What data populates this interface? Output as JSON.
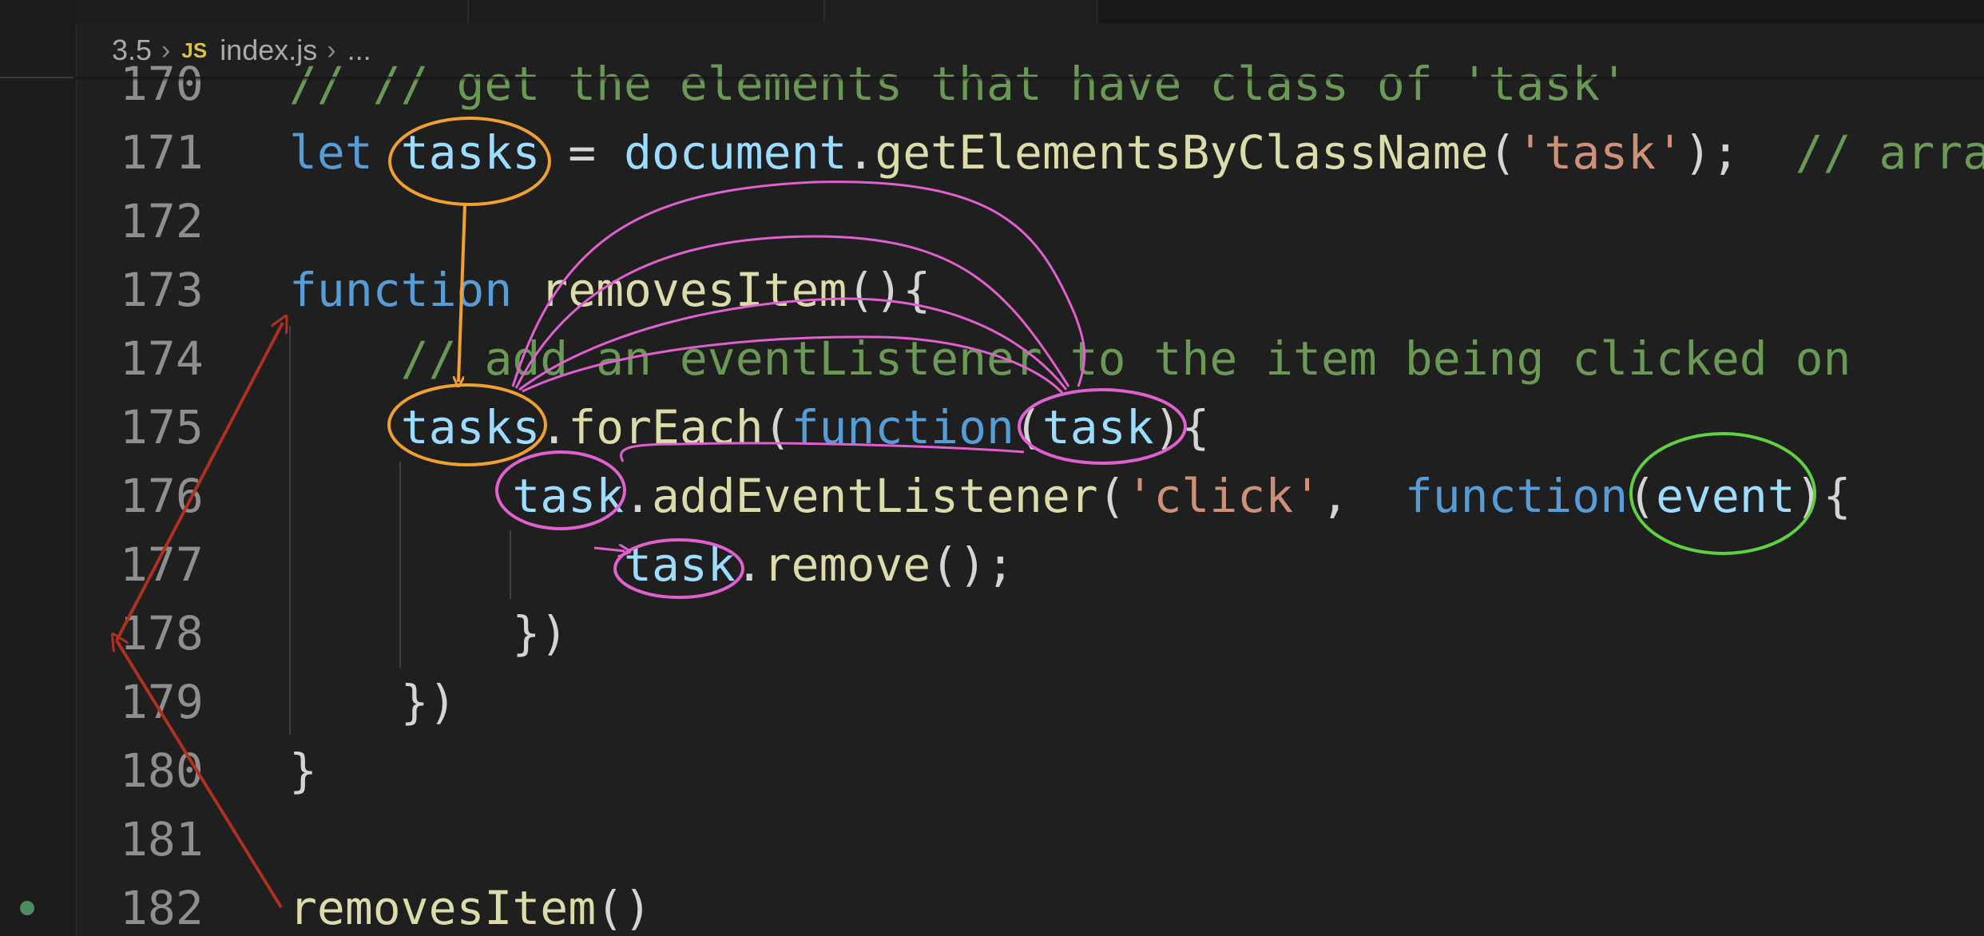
{
  "breadcrumb": {
    "folder": "3.5",
    "file_icon": "JS",
    "file": "index.js",
    "more": "..."
  },
  "colors": {
    "background": "#1f1f1f",
    "keyword": "#569cd6",
    "variable": "#9cdcfe",
    "function": "#dcdcaa",
    "string": "#ce9178",
    "comment": "#6a9955",
    "annotation_orange": "#f0a030",
    "annotation_magenta": "#e060d0",
    "annotation_green": "#60d040",
    "annotation_red": "#b03020"
  },
  "code_lines": [
    {
      "number": "170",
      "tokens": [
        {
          "t": "// // get the elements that have class of 'task'",
          "c": "cm"
        }
      ]
    },
    {
      "number": "171",
      "tokens": [
        {
          "t": "let ",
          "c": "kw"
        },
        {
          "t": "tasks",
          "c": "var"
        },
        {
          "t": " = ",
          "c": "pn"
        },
        {
          "t": "document",
          "c": "var"
        },
        {
          "t": ".",
          "c": "pn"
        },
        {
          "t": "getElementsByClassName",
          "c": "fn"
        },
        {
          "t": "(",
          "c": "pn"
        },
        {
          "t": "'task'",
          "c": "str"
        },
        {
          "t": ");  ",
          "c": "pn"
        },
        {
          "t": "// array",
          "c": "cm"
        }
      ]
    },
    {
      "number": "172",
      "tokens": []
    },
    {
      "number": "173",
      "tokens": [
        {
          "t": "function ",
          "c": "kw"
        },
        {
          "t": "removesItem",
          "c": "fn"
        },
        {
          "t": "(){",
          "c": "pn"
        }
      ]
    },
    {
      "number": "174",
      "tokens": [
        {
          "t": "    ",
          "c": "pn"
        },
        {
          "t": "// add an eventListener to the item being clicked on",
          "c": "cm"
        }
      ]
    },
    {
      "number": "175",
      "tokens": [
        {
          "t": "    ",
          "c": "pn"
        },
        {
          "t": "tasks",
          "c": "var"
        },
        {
          "t": ".",
          "c": "pn"
        },
        {
          "t": "forEach",
          "c": "fn"
        },
        {
          "t": "(",
          "c": "pn"
        },
        {
          "t": "function",
          "c": "kw"
        },
        {
          "t": "(",
          "c": "pn"
        },
        {
          "t": "task",
          "c": "var"
        },
        {
          "t": "){",
          "c": "pn"
        }
      ]
    },
    {
      "number": "176",
      "tokens": [
        {
          "t": "        ",
          "c": "pn"
        },
        {
          "t": "task",
          "c": "var"
        },
        {
          "t": ".",
          "c": "pn"
        },
        {
          "t": "addEventListener",
          "c": "fn"
        },
        {
          "t": "(",
          "c": "pn"
        },
        {
          "t": "'click'",
          "c": "str"
        },
        {
          "t": ",  ",
          "c": "pn"
        },
        {
          "t": "function",
          "c": "kw"
        },
        {
          "t": "(",
          "c": "pn"
        },
        {
          "t": "event",
          "c": "var"
        },
        {
          "t": "){",
          "c": "pn"
        }
      ]
    },
    {
      "number": "177",
      "tokens": [
        {
          "t": "            ",
          "c": "pn"
        },
        {
          "t": "task",
          "c": "var"
        },
        {
          "t": ".",
          "c": "pn"
        },
        {
          "t": "remove",
          "c": "fn"
        },
        {
          "t": "();",
          "c": "pn"
        }
      ]
    },
    {
      "number": "178",
      "tokens": [
        {
          "t": "        })",
          "c": "pn"
        }
      ]
    },
    {
      "number": "179",
      "tokens": [
        {
          "t": "    })",
          "c": "pn"
        }
      ]
    },
    {
      "number": "180",
      "tokens": [
        {
          "t": "}",
          "c": "pn"
        }
      ]
    },
    {
      "number": "181",
      "tokens": []
    },
    {
      "number": "182",
      "tokens": [
        {
          "t": "removesItem",
          "c": "fn"
        },
        {
          "t": "()",
          "c": "pn"
        }
      ]
    }
  ]
}
